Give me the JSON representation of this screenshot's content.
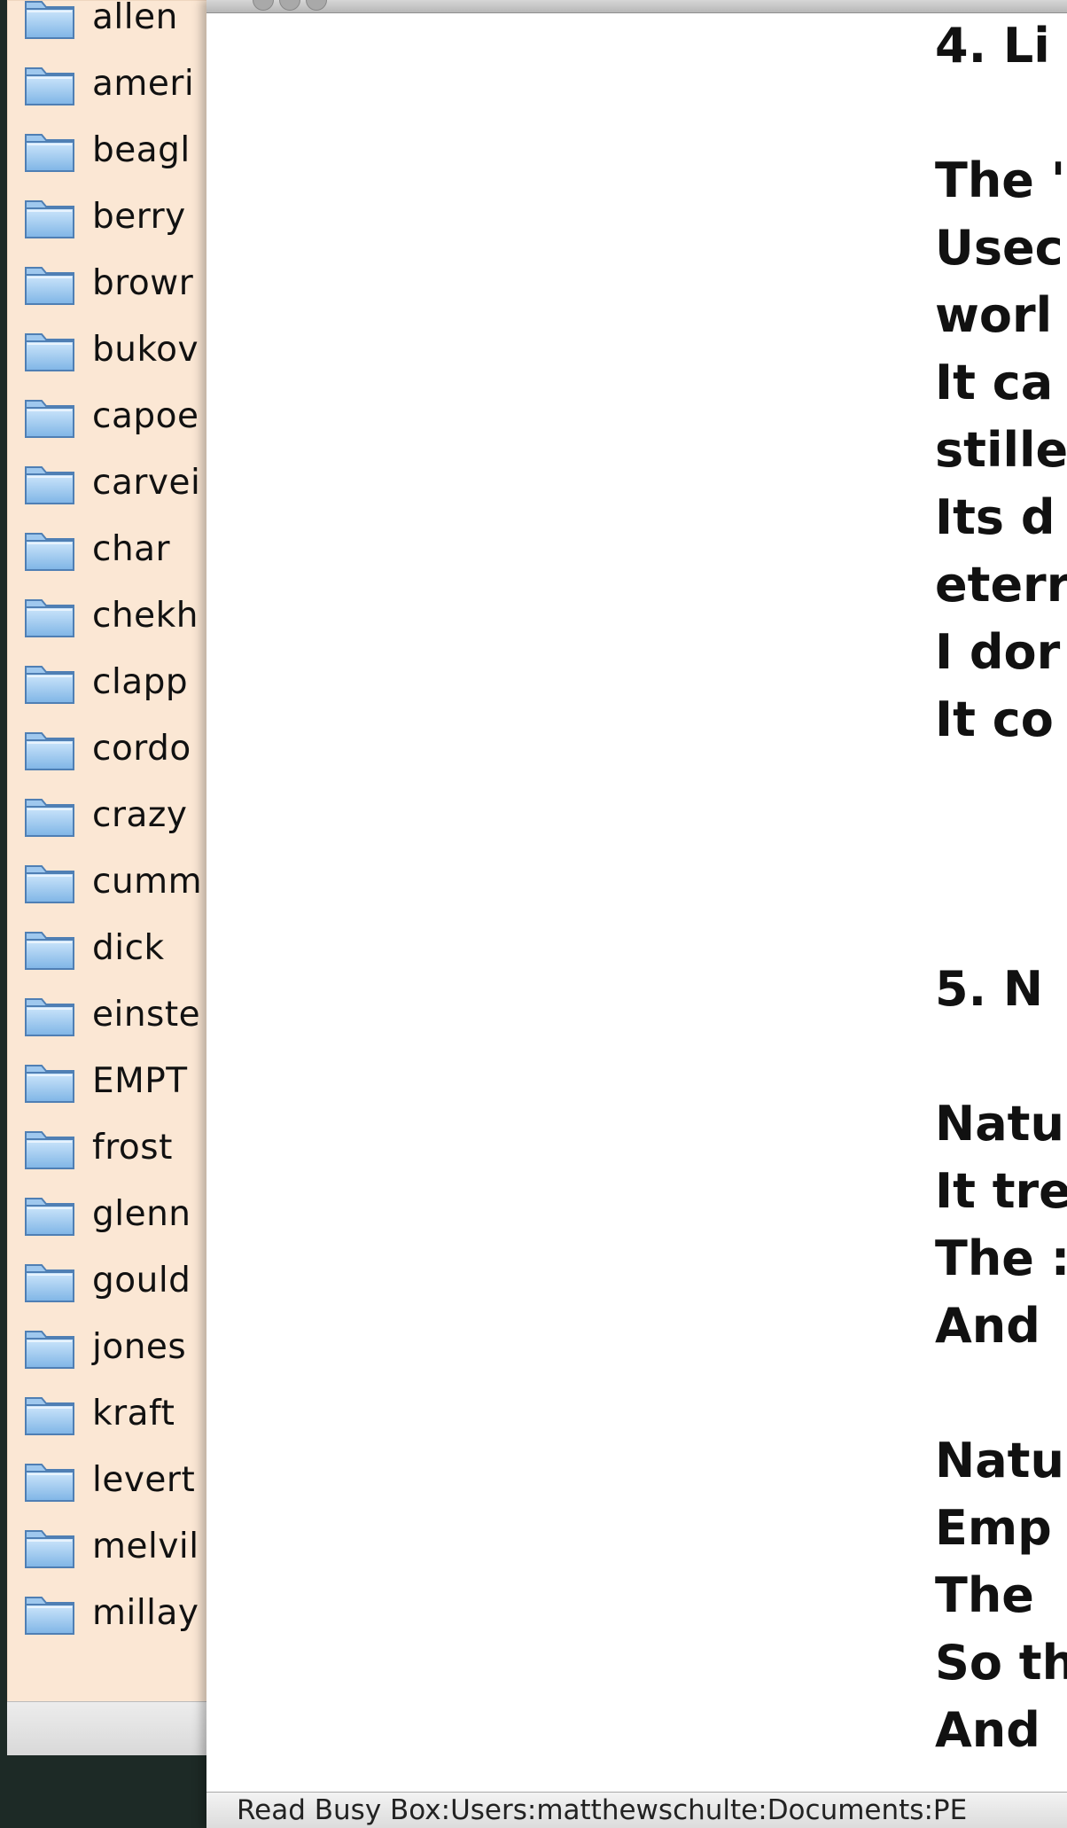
{
  "sidebar": {
    "folders": [
      "allen",
      "ameri",
      "beagl",
      "berry",
      "browr",
      "bukov",
      "capoe",
      "carvei",
      "char",
      "chekh",
      "clapp",
      "cordo",
      "crazy",
      "cumm",
      "dick",
      "einste",
      "EMPT",
      "frost",
      "glenn",
      "gould",
      "jones",
      "kraft",
      "levert",
      "melvil",
      "millay"
    ]
  },
  "document": {
    "lines": [
      "4. Li",
      "",
      "The '",
      "Usec",
      "worl",
      "It ca",
      "stille",
      "Its d",
      "eterr",
      "I dor",
      "It co",
      "",
      "",
      "",
      "5. N",
      "",
      "Natu",
      "It tre",
      "The :",
      "And",
      "",
      "Natu",
      "Emp",
      "The",
      "So th",
      "And"
    ]
  },
  "status_bar": {
    "path": "Read Busy Box:Users:matthewschulte:Documents:PE"
  }
}
